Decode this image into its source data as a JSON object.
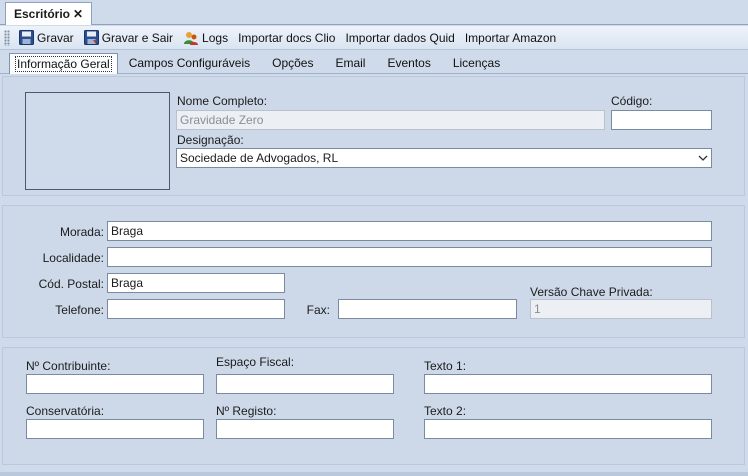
{
  "document_tab": {
    "title": "Escritório",
    "close": "✕"
  },
  "toolbar": {
    "save": "Gravar",
    "save_exit": "Gravar e Sair",
    "logs": "Logs",
    "import_clio": "Importar docs Clio",
    "import_quid": "Importar dados Quid",
    "import_amazon": "Importar Amazon"
  },
  "tabs": [
    "Informação Geral",
    "Campos Configuráveis",
    "Opções",
    "Email",
    "Eventos",
    "Licenças"
  ],
  "general": {
    "full_name_label": "Nome Completo:",
    "full_name_value": "Gravidade Zero",
    "code_label": "Código:",
    "code_value": "",
    "designation_label": "Designação:",
    "designation_value": "Sociedade de Advogados, RL"
  },
  "address": {
    "morada_label": "Morada:",
    "morada_value": "Braga",
    "localidade_label": "Localidade:",
    "localidade_value": "",
    "postal_label": "Cód. Postal:",
    "postal_value": "Braga",
    "phone_label": "Telefone:",
    "phone_value": "",
    "fax_label": "Fax:",
    "fax_value": "",
    "key_version_label": "Versão Chave Privada:",
    "key_version_value": "1"
  },
  "fiscal": {
    "nif_label": "Nº Contribuinte:",
    "nif_value": "",
    "fiscal_space_label": "Espaço Fiscal:",
    "fiscal_space_value": "",
    "text1_label": "Texto 1:",
    "text1_value": "",
    "registry_office_label": "Conservatória:",
    "registry_office_value": "",
    "registry_no_label": "Nº Registo:",
    "registry_no_value": "",
    "text2_label": "Texto 2:",
    "text2_value": ""
  }
}
